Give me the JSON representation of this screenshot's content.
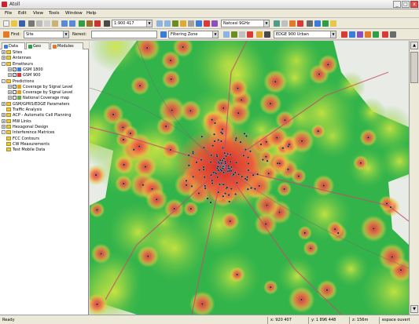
{
  "window": {
    "title": "Atoll",
    "min": "_",
    "max": "□",
    "close": "x"
  },
  "menu": [
    "File",
    "Edit",
    "View",
    "Tools",
    "Window",
    "Help"
  ],
  "toolbar1": {
    "scale": "1:900 417",
    "network": "Natcesl 9GHz"
  },
  "toolbar2": {
    "find_label": "Find:",
    "find_value": "Site",
    "nearest_label": "Nerest:",
    "zone_label": "Filtering Zone",
    "layer_label": "EDGE 900 Urban"
  },
  "tabs": [
    "Data",
    "Geo",
    "Modules"
  ],
  "tree": [
    {
      "label": "Sites",
      "level": 0,
      "type": "folder",
      "exp": "+"
    },
    {
      "label": "Antennes",
      "level": 0,
      "type": "folder",
      "exp": "+"
    },
    {
      "label": "Emetteurs",
      "level": 0,
      "type": "folder",
      "exp": "-"
    },
    {
      "label": "GSM 1800",
      "level": 1,
      "type": "layer",
      "exp": "+",
      "check": true,
      "color": "#3a7dd8"
    },
    {
      "label": "GSM 900",
      "level": 1,
      "type": "layer",
      "exp": "+",
      "check": true,
      "color": "#d83a3a"
    },
    {
      "label": "Predictions",
      "level": 0,
      "type": "folder",
      "exp": "-"
    },
    {
      "label": "Coverage by Signal Level",
      "level": 1,
      "type": "layer",
      "exp": "+",
      "check": true,
      "color": "#e0a020"
    },
    {
      "label": "Coverage by Signal Level",
      "level": 1,
      "type": "layer",
      "exp": "+",
      "check": false,
      "color": "#e0a020"
    },
    {
      "label": "National Coverage map",
      "level": 1,
      "type": "layer",
      "exp": "+",
      "check": false,
      "color": "#6aa84f"
    },
    {
      "label": "GSM/GPRS/EDGE Parameters",
      "level": 0,
      "type": "folder",
      "exp": "+"
    },
    {
      "label": "Traffic Analysis",
      "level": 0,
      "type": "folder",
      "exp": ""
    },
    {
      "label": "ACP - Automatic Cell Planning",
      "level": 0,
      "type": "folder",
      "exp": "+"
    },
    {
      "label": "MW Links",
      "level": 0,
      "type": "folder",
      "exp": "+"
    },
    {
      "label": "Hexagonal Design",
      "level": 0,
      "type": "folder",
      "exp": "+"
    },
    {
      "label": "Interference Matrices",
      "level": 0,
      "type": "folder",
      "exp": "-"
    },
    {
      "label": "FCC Contours",
      "level": 0,
      "type": "folder",
      "exp": ""
    },
    {
      "label": "CW Measurements",
      "level": 0,
      "type": "folder",
      "exp": ""
    },
    {
      "label": "Test Mobile Data",
      "level": 0,
      "type": "folder",
      "exp": ""
    }
  ],
  "status": {
    "ready": "Ready",
    "x": "x: 920 407",
    "y": "y: 1 896 448",
    "z": "z: 156m",
    "clutter": "espace ouvert"
  }
}
